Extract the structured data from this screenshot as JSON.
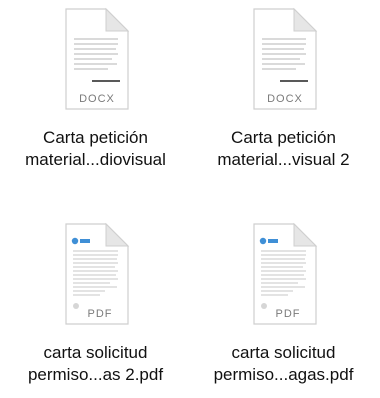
{
  "files": [
    {
      "type_label": "DOCX",
      "kind": "docx",
      "icon": "docx-file-icon",
      "name_line1": "Carta petición",
      "name_line2": "material...diovisual"
    },
    {
      "type_label": "DOCX",
      "kind": "docx",
      "icon": "docx-file-icon",
      "name_line1": "Carta petición",
      "name_line2": "material...visual  2"
    },
    {
      "type_label": "PDF",
      "kind": "pdf",
      "icon": "pdf-file-icon",
      "name_line1": "carta solicitud",
      "name_line2": "permiso...as 2.pdf"
    },
    {
      "type_label": "PDF",
      "kind": "pdf",
      "icon": "pdf-file-icon",
      "name_line1": "carta solicitud",
      "name_line2": "permiso...agas.pdf"
    }
  ],
  "colors": {
    "page_border": "#cfcfcf",
    "fold": "#e6e6e6",
    "type_label": "#7a7a7a",
    "text_lines": "#9a9a9a",
    "pdf_logo": "#3f8fd6"
  }
}
